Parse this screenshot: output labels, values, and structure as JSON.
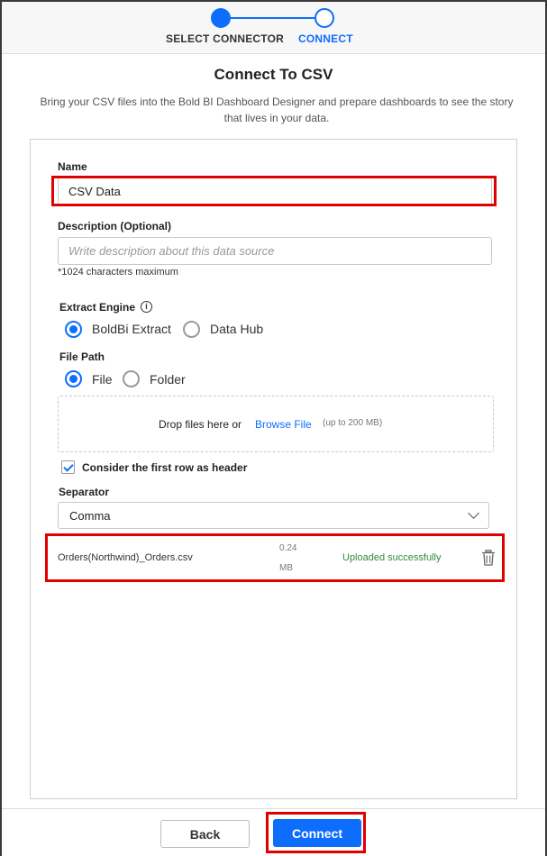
{
  "stepper": {
    "step1_label": "SELECT CONNECTOR",
    "step2_label": "CONNECT"
  },
  "header": {
    "title": "Connect To CSV",
    "subtitle": "Bring your CSV files into the Bold BI Dashboard Designer and prepare dashboards to see the story that lives in your data."
  },
  "form": {
    "name_label": "Name",
    "name_value": "CSV Data",
    "description_label": "Description (Optional)",
    "description_placeholder": "Write description about this data source",
    "description_hint": "*1024 characters maximum",
    "extract_engine_label": "Extract Engine",
    "extract_engine_options": [
      {
        "label": "BoldBi Extract",
        "selected": true
      },
      {
        "label": "Data Hub",
        "selected": false
      }
    ],
    "file_path_label": "File Path",
    "file_path_options": [
      {
        "label": "File",
        "selected": true
      },
      {
        "label": "Folder",
        "selected": false
      }
    ],
    "dropzone_text": "Drop files here or",
    "dropzone_link": "Browse File",
    "dropzone_size": "(up to 200 MB)",
    "header_checkbox_label": "Consider the first row as header",
    "header_checkbox_checked": true,
    "separator_label": "Separator",
    "separator_value": "Comma"
  },
  "uploaded_file": {
    "name": "Orders(Northwind)_Orders.csv",
    "size_value": "0.24",
    "size_unit": "MB",
    "status": "Uploaded successfully"
  },
  "footer": {
    "back_label": "Back",
    "connect_label": "Connect"
  },
  "colors": {
    "accent": "#0d6efd",
    "highlight": "#e00000",
    "success": "#2e8b3a"
  },
  "icons": {
    "info": "info-icon",
    "trash": "trash-icon",
    "chevron": "chevron-down-icon"
  }
}
